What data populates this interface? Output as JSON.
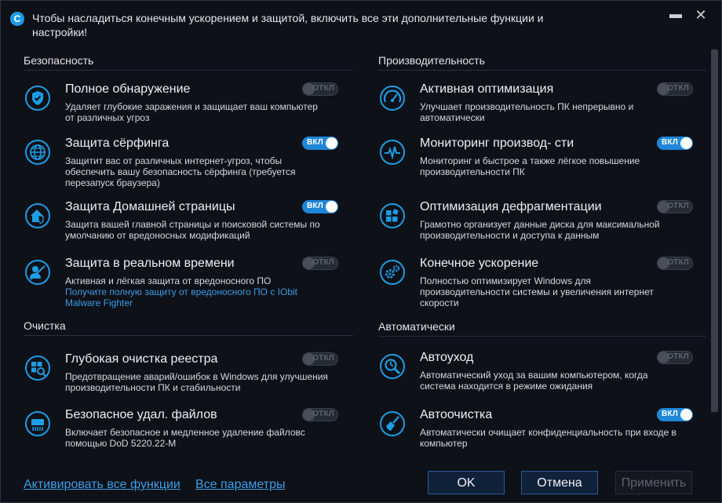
{
  "window": {
    "title": "Чтобы насладиться конечным ускорением и защитой, включить все эти дополнительные функции и настройки!",
    "logo_letter": "C",
    "minimize_glyph": "▬",
    "close_glyph": "✕"
  },
  "sections": {
    "security": "Безопасность",
    "performance": "Производительность",
    "cleaning": "Очистка",
    "automatic": "Автоматически"
  },
  "toggle_labels": {
    "on": "ВКЛ",
    "off": "ОТКЛ"
  },
  "items": {
    "full_detection": {
      "name": "Полное обнаружение",
      "desc": "Удаляет глубокие заражения и защищает ваш компьютер от различных угроз",
      "state": "off",
      "icon": "shield-check-icon"
    },
    "surf_protection": {
      "name": "Защита сёрфинга",
      "desc": "Защитит вас от различных интернет-угроз, чтобы обеспечить вашу безопасность сёрфинга (требуется перезапуск браузера)",
      "state": "on",
      "icon": "globe-icon"
    },
    "homepage_protection": {
      "name": "Защита Домашней страницы",
      "desc": "Защита вашей главной страницы и поисковой системы по умолчанию от вредоносных модификаций",
      "state": "on",
      "icon": "home-shield-icon"
    },
    "realtime_protection": {
      "name": "Защита в реальном времени",
      "desc": "Активная и лёгкая защита от вредоносного ПО",
      "link": "Получите полную защиту от вредоносного ПО с IObit Malware Fighter",
      "state": "off",
      "icon": "user-shield-icon"
    },
    "active_optimization": {
      "name": "Активная оптимизация",
      "desc": "Улучшает производительность ПК непрерывно и автоматически",
      "state": "off",
      "icon": "gauge-icon"
    },
    "perf_monitoring": {
      "name": "Мониторинг производ- сти",
      "desc": "Мониторинг и быстрое а также лёгкое повышение производительности ПК",
      "state": "on",
      "icon": "monitor-pulse-icon"
    },
    "defrag_optimization": {
      "name": "Оптимизация дефрагментации",
      "desc": "Грамотно организует данные диска для максимальной производительности и доступа к данным",
      "state": "off",
      "icon": "defrag-blocks-icon"
    },
    "ultimate_boost": {
      "name": "Конечное ускорение",
      "desc": "Полностью оптимизирует Windows для производительности системы и увеличения интернет скорости",
      "state": "off",
      "icon": "gears-icon"
    },
    "deep_registry": {
      "name": "Глубокая очистка реестра",
      "desc": "Предотвращение аварий/ошибок  в Windows  для улучшения производительности ПК и стабильности",
      "state": "off",
      "icon": "registry-search-icon"
    },
    "secure_delete": {
      "name": "Безопасное удал. файлов",
      "desc": "Включает безопасное и медленное удаление файловс помощью DoD 5220.22-M",
      "state": "off",
      "icon": "shredder-icon"
    },
    "auto_care": {
      "name": "Автоуход",
      "desc": "Автоматический уход за вашим компьютером, когда система находится в режиме ожидания",
      "state": "off",
      "icon": "magnifier-clock-icon"
    },
    "auto_clean": {
      "name": "Автоочистка",
      "desc": "Автоматически очищает конфиденциальность при входе в компьютер",
      "state": "on",
      "icon": "broom-icon"
    }
  },
  "footer": {
    "activate_all": "Активировать все функции",
    "all_settings": "Все параметры",
    "ok": "OK",
    "cancel": "Отмена",
    "apply": "Применить"
  },
  "colors": {
    "accent": "#1f86d8",
    "link": "#3b9de6",
    "background": "#0e1117",
    "icon": "#1e9ce5"
  }
}
